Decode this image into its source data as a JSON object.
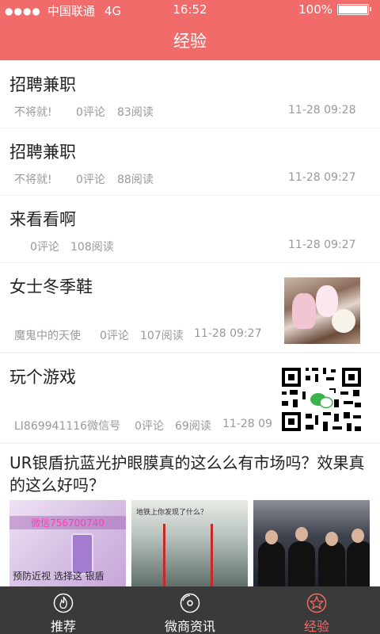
{
  "statusbar": {
    "carrier": "中国联通",
    "network": "4G",
    "time": "16:52",
    "battery": "100%"
  },
  "navbar": {
    "title": "经验"
  },
  "feed": [
    {
      "title": "招聘兼职",
      "author": "不将就!",
      "comments": "0评论",
      "reads": "83阅读",
      "time": "11-28 09:28"
    },
    {
      "title": "招聘兼职",
      "author": "不将就!",
      "comments": "0评论",
      "reads": "88阅读",
      "time": "11-28 09:27"
    },
    {
      "title": "来看看啊",
      "comments": "0评论",
      "reads": "108阅读",
      "time": "11-28 09:27"
    },
    {
      "title": "女士冬季鞋",
      "author": "魔鬼中的天使",
      "comments": "0评论",
      "reads": "107阅读",
      "time": "11-28 09:27",
      "thumb": "shoes-photo"
    },
    {
      "title": "玩个游戏",
      "author": "LI869941116微信号",
      "comments": "0评论",
      "reads": "69阅读",
      "time": "11-28 09:",
      "thumb": "wechat-qr-code"
    }
  ],
  "article": {
    "title": "UR银盾抗蓝光护眼膜真的这么么有市场吗？效果真的这么好吗？",
    "images": [
      {
        "name": "product-ad",
        "banner": "微信756700740",
        "caption": "预防近视 选择这 银盾"
      },
      {
        "name": "subway-photo",
        "caption": "地铁上你发现了什么？"
      },
      {
        "name": "conference-photo"
      }
    ]
  },
  "tabbar": [
    {
      "label": "推荐",
      "icon": "flame-icon",
      "active": false
    },
    {
      "label": "微商资讯",
      "icon": "disc-icon",
      "active": false
    },
    {
      "label": "经验",
      "icon": "star-icon",
      "active": true
    }
  ],
  "colors": {
    "accent": "#f26b6b",
    "tabbar": "#3a3a3a",
    "meta_text": "#999999"
  }
}
